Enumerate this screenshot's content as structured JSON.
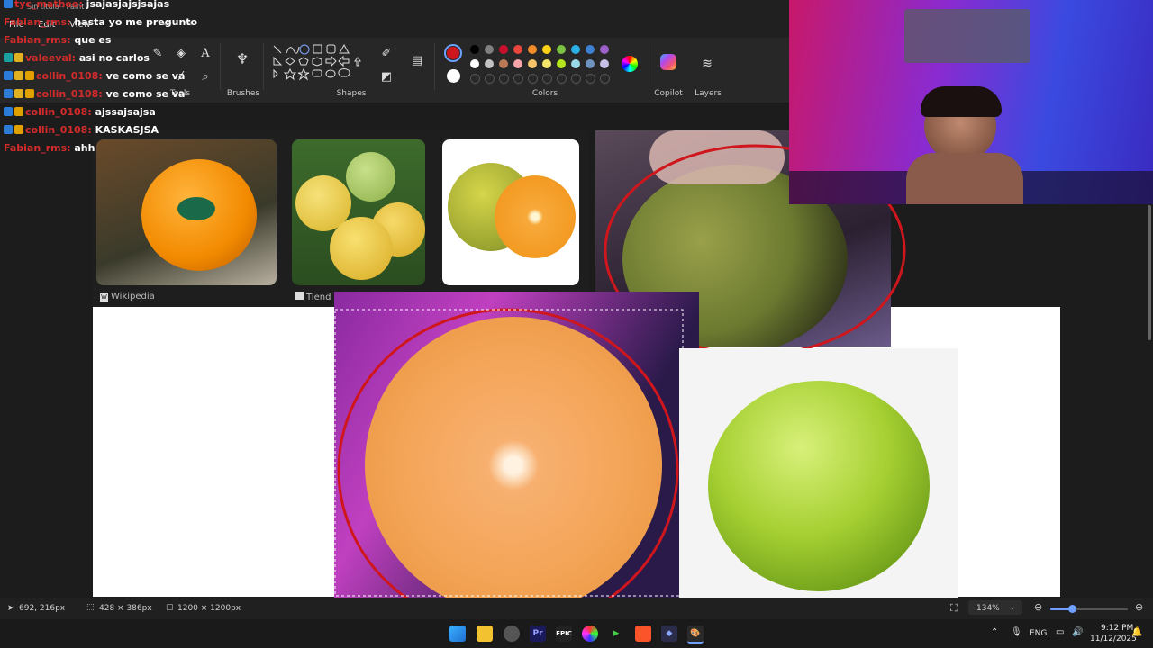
{
  "menu": {
    "file": "File",
    "edit": "Edit",
    "view": "View"
  },
  "title_overlay": "Sin título - Paint",
  "ribbon": {
    "groups": {
      "tools": "Tools",
      "brushes": "Brushes",
      "shapes": "Shapes",
      "colors": "Colors",
      "copilot": "Copilot",
      "layers": "Layers"
    },
    "primary_color": "#d0161d",
    "secondary_color": "#ffffff",
    "palette_row1": [
      "#000000",
      "#7f7f7f",
      "#c8102e",
      "#e8453c",
      "#f28c28",
      "#fcd116",
      "#7bc142",
      "#2bb0e5",
      "#3d7fd1",
      "#9a5fc8"
    ],
    "palette_row2": [
      "#ffffff",
      "#c3c3c3",
      "#b97a57",
      "#f4a3a8",
      "#f7c36a",
      "#f6e56b",
      "#b5e61d",
      "#99d9ea",
      "#7092be",
      "#c8bfe7"
    ]
  },
  "chat": [
    {
      "user": "tyc_matheo",
      "msg": "jsajasjajsjsajas",
      "badges": [
        "#2b7bd8"
      ]
    },
    {
      "user": "Fabian_rms",
      "msg": "hasta yo me pregunto",
      "badges": []
    },
    {
      "user": "Fabian_rms",
      "msg": "que es",
      "badges": []
    },
    {
      "user": "valeeval",
      "msg": "asi no carlos",
      "badges": [
        "#1aa0a0",
        "#e0b020"
      ]
    },
    {
      "user": "collin_0108",
      "msg": "ve como se va",
      "badges": [
        "#2b7bd8",
        "#e0b020",
        "#e0a000"
      ]
    },
    {
      "user": "collin_0108",
      "msg": "ve como se va",
      "badges": [
        "#2b7bd8",
        "#e0b020",
        "#e0a000"
      ]
    },
    {
      "user": "collin_0108",
      "msg": "ajssajsajsa",
      "badges": [
        "#2b7bd8",
        "#e0a000"
      ]
    },
    {
      "user": "collin_0108",
      "msg": "KASKASJSA",
      "badges": [
        "#2b7bd8",
        "#e0a000"
      ]
    },
    {
      "user": "Fabian_rms",
      "msg": "ahh",
      "badges": []
    }
  ],
  "search_results": {
    "source1": "Wikipedia",
    "source2": "Tiend"
  },
  "status": {
    "cursor_pos": "692, 216px",
    "selection_size": "428 × 386px",
    "canvas_size": "1200 × 1200px",
    "zoom": "134%",
    "zoom_level": 0.28
  },
  "taskbar": {
    "lang": "ENG",
    "time": "9:12 PM",
    "date": "11/12/2025"
  }
}
